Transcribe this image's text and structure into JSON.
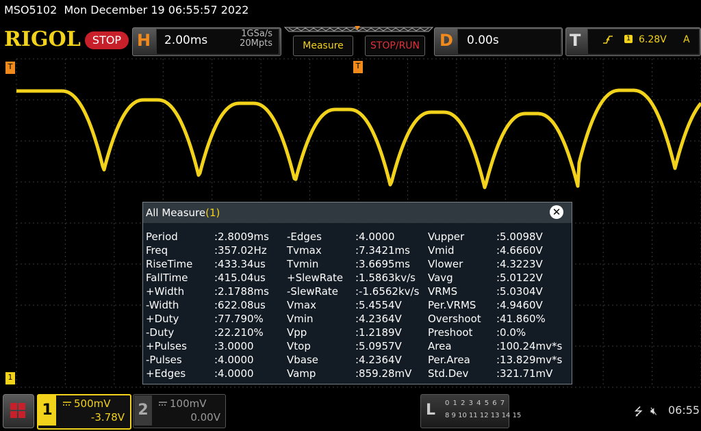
{
  "title_bar": {
    "text": "MSO5102  Mon December 19 06:55:57 2022"
  },
  "brand": {
    "logo": "RIGOL",
    "run_state": "STOP"
  },
  "horizontal": {
    "letter": "H",
    "timebase": "2.00ms",
    "sample_rate": "1GSa/s",
    "memory_depth": "20Mpts"
  },
  "buttons": {
    "measure": "Measure",
    "stop_run": "STOP/RUN"
  },
  "delay": {
    "letter": "D",
    "value": "0.00s"
  },
  "trigger": {
    "letter": "T",
    "source": "1",
    "level": "6.28V",
    "mode": "A",
    "slope_icon": "rising-edge-icon"
  },
  "markers": {
    "top_left": "T",
    "bottom_left": "1",
    "trigger_pos": "T"
  },
  "measure_dialog": {
    "title": "All Measure",
    "count": "(1)",
    "close_icon": "close-icon",
    "columns": [
      [
        {
          "name": "Period",
          "value": ":2.8009ms"
        },
        {
          "name": "Freq",
          "value": ":357.02Hz"
        },
        {
          "name": "RiseTime",
          "value": ":433.34us"
        },
        {
          "name": "FallTime",
          "value": ":415.04us"
        },
        {
          "name": "+Width",
          "value": ":2.1788ms"
        },
        {
          "name": "-Width",
          "value": ":622.08us"
        },
        {
          "name": "+Duty",
          "value": ":77.790%"
        },
        {
          "name": "-Duty",
          "value": ":22.210%"
        },
        {
          "name": "+Pulses",
          "value": ":3.0000"
        },
        {
          "name": "-Pulses",
          "value": ":4.0000"
        },
        {
          "name": "+Edges",
          "value": ":4.0000"
        }
      ],
      [
        {
          "name": "-Edges",
          "value": ":4.0000"
        },
        {
          "name": "Tvmax",
          "value": ":7.3421ms"
        },
        {
          "name": "Tvmin",
          "value": ":3.6695ms"
        },
        {
          "name": "+SlewRate",
          "value": ":1.5863kv/s"
        },
        {
          "name": "-SlewRate",
          "value": ":-1.6562kv/s"
        },
        {
          "name": "Vmax",
          "value": ":5.4554V"
        },
        {
          "name": "Vmin",
          "value": ":4.2364V"
        },
        {
          "name": "Vpp",
          "value": ":1.2189V"
        },
        {
          "name": "Vtop",
          "value": ":5.0957V"
        },
        {
          "name": "Vbase",
          "value": ":4.2364V"
        },
        {
          "name": "Vamp",
          "value": ":859.28mV"
        }
      ],
      [
        {
          "name": "Vupper",
          "value": ":5.0098V"
        },
        {
          "name": "Vmid",
          "value": ":4.6660V"
        },
        {
          "name": "Vlower",
          "value": ":4.3223V"
        },
        {
          "name": "Vavg",
          "value": ":5.0122V"
        },
        {
          "name": "VRMS",
          "value": ":5.0304V"
        },
        {
          "name": "Per.VRMS",
          "value": ":4.9460V"
        },
        {
          "name": "Overshoot",
          "value": ":41.860%"
        },
        {
          "name": "Preshoot",
          "value": ":0.0%"
        },
        {
          "name": "Area",
          "value": ":100.24mv*s"
        },
        {
          "name": "Per.Area",
          "value": ":13.829mv*s"
        },
        {
          "name": "Std.Dev",
          "value": ":321.71mV"
        }
      ]
    ]
  },
  "channels": [
    {
      "num": "1",
      "scale": "500mV",
      "offset": "-3.78V",
      "color": "#f2d21a"
    },
    {
      "num": "2",
      "scale": "100mV",
      "offset": "0.00V",
      "color": "#999999"
    }
  ],
  "la": {
    "letter": "L",
    "row1": "0 1 2 3  4 5 6 7",
    "row2": "8 9 10 11  12 13 14 15"
  },
  "status": {
    "clock": "06:55",
    "usb_icon": "usb-icon",
    "sound_icon": "speaker-muted-icon"
  },
  "colors": {
    "accent_yellow": "#f2d21a",
    "accent_orange": "#f08a1c",
    "stop_red": "#c8202a"
  }
}
